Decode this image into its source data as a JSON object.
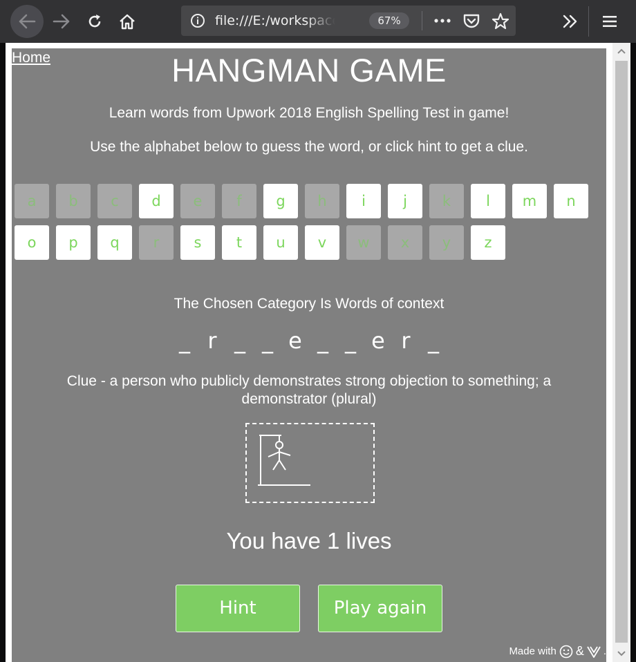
{
  "browser": {
    "url": "file:///E:/workspace",
    "zoom": "67%"
  },
  "page": {
    "home_link": "Home",
    "title": "HANGMAN GAME",
    "subtitle1": "Learn words from Upwork 2018 English Spelling Test in game!",
    "subtitle2": "Use the alphabet below to guess the word, or click hint to get a clue.",
    "category": "The Chosen Category Is Words of context",
    "clue": "Clue - a person who publicly demonstrates strong objection to something; a demonstrator (plural)",
    "lives": "You have 1 lives",
    "hint_button": "Hint",
    "play_again_button": "Play again",
    "made_with": "Made with",
    "made_with_amp": "&",
    "made_with_dot": "."
  },
  "alphabet": [
    {
      "letter": "a",
      "used": true
    },
    {
      "letter": "b",
      "used": true
    },
    {
      "letter": "c",
      "used": true
    },
    {
      "letter": "d",
      "used": false
    },
    {
      "letter": "e",
      "used": true
    },
    {
      "letter": "f",
      "used": true
    },
    {
      "letter": "g",
      "used": false
    },
    {
      "letter": "h",
      "used": true
    },
    {
      "letter": "i",
      "used": false
    },
    {
      "letter": "j",
      "used": false
    },
    {
      "letter": "k",
      "used": true
    },
    {
      "letter": "l",
      "used": false
    },
    {
      "letter": "m",
      "used": false
    },
    {
      "letter": "n",
      "used": false
    },
    {
      "letter": "o",
      "used": false
    },
    {
      "letter": "p",
      "used": false
    },
    {
      "letter": "q",
      "used": false
    },
    {
      "letter": "r",
      "used": true
    },
    {
      "letter": "s",
      "used": false
    },
    {
      "letter": "t",
      "used": false
    },
    {
      "letter": "u",
      "used": false
    },
    {
      "letter": "v",
      "used": false
    },
    {
      "letter": "w",
      "used": true
    },
    {
      "letter": "x",
      "used": true
    },
    {
      "letter": "y",
      "used": true
    },
    {
      "letter": "z",
      "used": false
    }
  ],
  "word": [
    "_",
    "r",
    "_",
    "_",
    "e",
    "_",
    "_",
    "e",
    "r",
    "_"
  ],
  "colors": {
    "page_bg": "#808080",
    "letter_text": "#7cd65c",
    "button_bg": "#7ece63"
  }
}
